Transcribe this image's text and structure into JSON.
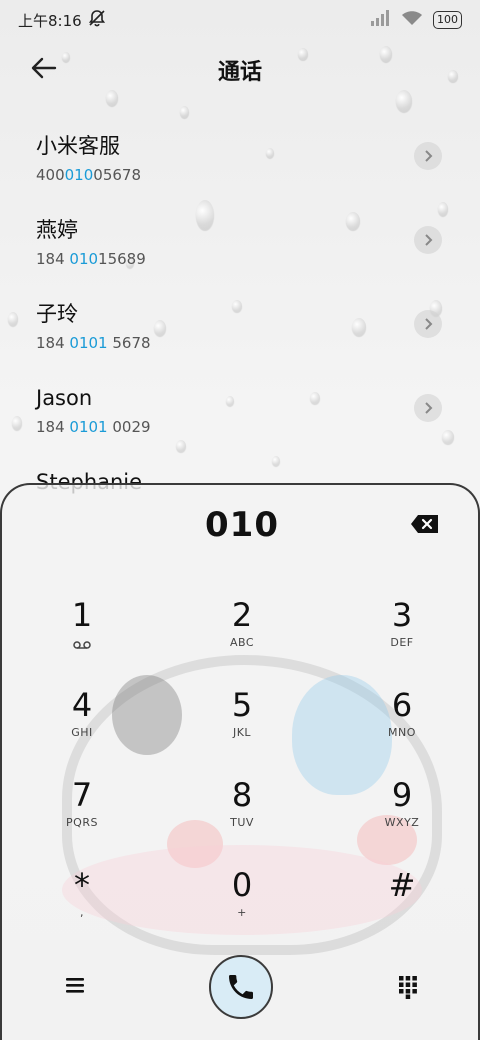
{
  "status_bar": {
    "time": "上午8:16",
    "battery": "100"
  },
  "header": {
    "title": "通话"
  },
  "contacts": [
    {
      "name": "小米客服",
      "number_pre": "400",
      "number_hl": "010",
      "number_post": "05678"
    },
    {
      "name": "燕婷",
      "number_pre": "184 ",
      "number_hl": "010",
      "number_post": "15689"
    },
    {
      "name": "子玲",
      "number_pre": "184 ",
      "number_hl": "0101",
      "number_post": " 5678"
    },
    {
      "name": "Jason",
      "number_pre": "184 ",
      "number_hl": "0101",
      "number_post": " 0029"
    },
    {
      "name": "Stephanie",
      "number_pre": "",
      "number_hl": "",
      "number_post": ""
    }
  ],
  "dialer": {
    "input": "010",
    "keys": [
      {
        "digit": "1",
        "letters": ""
      },
      {
        "digit": "2",
        "letters": "ABC"
      },
      {
        "digit": "3",
        "letters": "DEF"
      },
      {
        "digit": "4",
        "letters": "GHI"
      },
      {
        "digit": "5",
        "letters": "JKL"
      },
      {
        "digit": "6",
        "letters": "MNO"
      },
      {
        "digit": "7",
        "letters": "PQRS"
      },
      {
        "digit": "8",
        "letters": "TUV"
      },
      {
        "digit": "9",
        "letters": "WXYZ"
      },
      {
        "digit": "*",
        "letters": ","
      },
      {
        "digit": "0",
        "letters": "+"
      },
      {
        "digit": "#",
        "letters": ""
      }
    ]
  },
  "colors": {
    "highlight": "#1a9bd7",
    "call_button_bg": "#d9ecf6"
  },
  "icons": {
    "status": [
      "mute-bell-icon",
      "signal-icon",
      "wifi-icon",
      "battery-icon"
    ],
    "header": [
      "back-arrow-icon"
    ],
    "dialer": [
      "backspace-icon",
      "voicemail-icon",
      "menu-icon",
      "phone-icon",
      "keypad-icon"
    ]
  }
}
